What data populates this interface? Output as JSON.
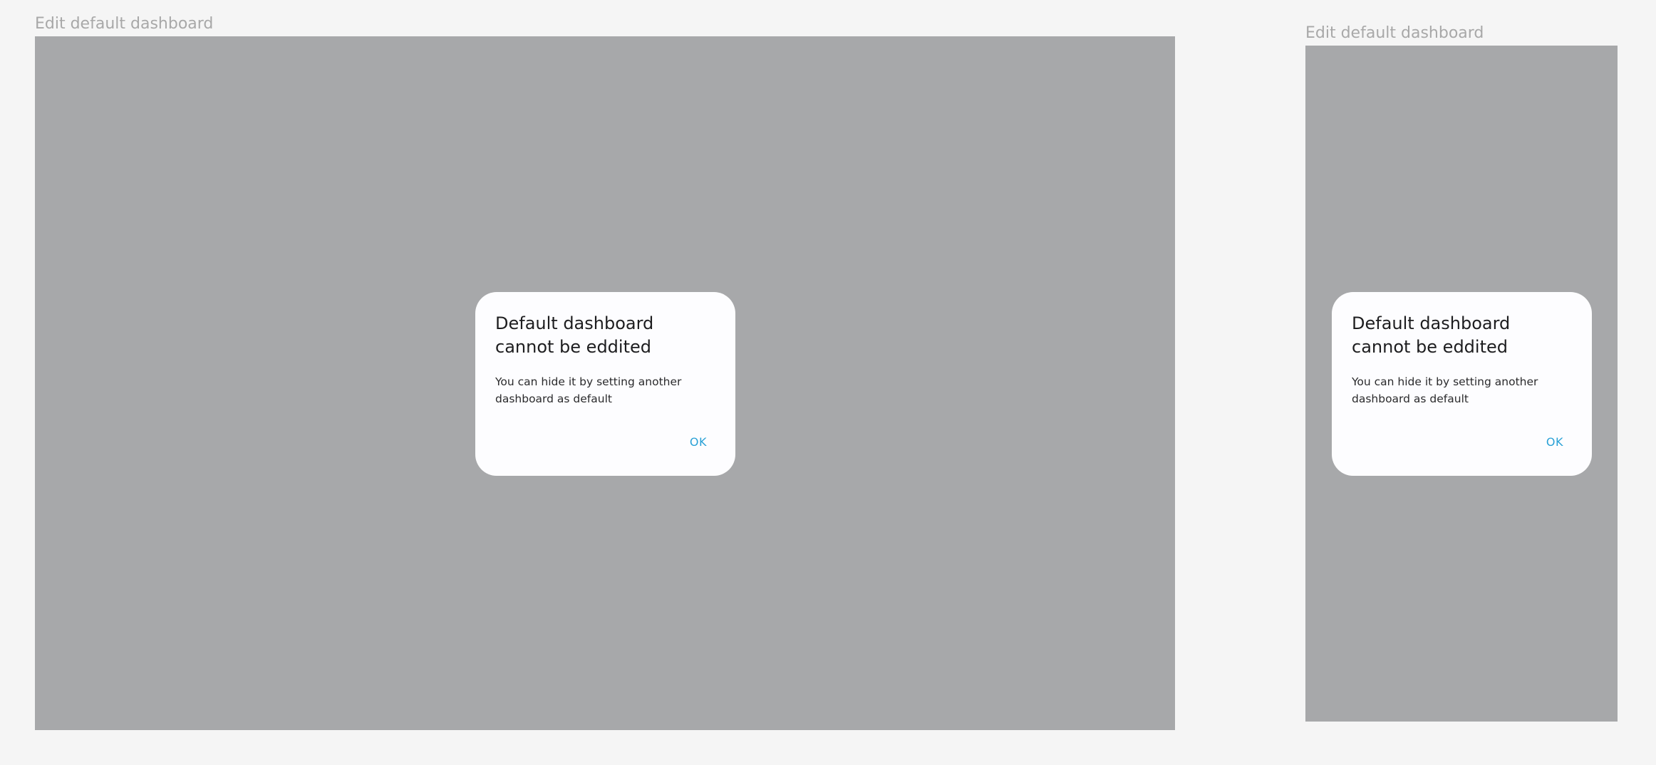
{
  "frames": [
    {
      "label": "Edit default dashboard",
      "dialog": {
        "title": "Default dashboard cannot be eddited",
        "body": "You can hide it by setting another dashboard as default",
        "ok_label": "OK"
      }
    },
    {
      "label": "Edit default dashboard",
      "dialog": {
        "title": "Default dashboard cannot be eddited",
        "body": "You can hide it by setting another dashboard as default",
        "ok_label": "OK"
      }
    }
  ],
  "colors": {
    "page_background": "#f5f5f5",
    "scrim": "#a7a8aa",
    "dialog_background": "#fdfdff",
    "accent": "#2aa1d6",
    "label_text": "#a8a8a8"
  }
}
